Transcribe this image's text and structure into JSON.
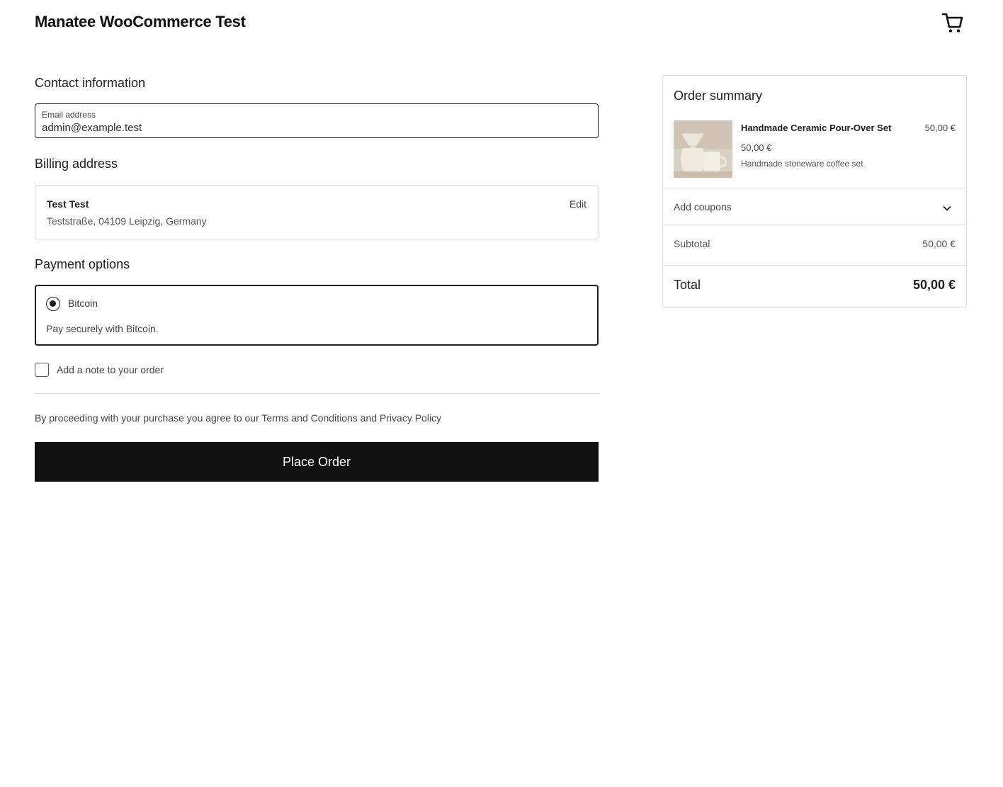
{
  "header": {
    "site_title": "Manatee WooCommerce Test",
    "cart_icon": "cart-icon"
  },
  "contact": {
    "title": "Contact information",
    "email_label": "Email address",
    "email_value": "admin@example.test"
  },
  "billing": {
    "title": "Billing address",
    "name": "Test Test",
    "address_line": "Teststraße, 04109 Leipzig, Germany",
    "edit_label": "Edit"
  },
  "payment": {
    "title": "Payment options",
    "selected_method": "Bitcoin",
    "description": "Pay securely with Bitcoin."
  },
  "note": {
    "label": "Add a note to your order",
    "checked": false
  },
  "terms_text": "By proceeding with your purchase you agree to our Terms and Conditions and Privacy Policy",
  "place_order_label": "Place Order",
  "summary": {
    "title": "Order summary",
    "item": {
      "name": "Handmade Ceramic Pour-Over Set",
      "line_total": "50,00 €",
      "unit_price": "50,00 €",
      "description": "Handmade stoneware coffee set"
    },
    "coupons_label": "Add coupons",
    "subtotal_label": "Subtotal",
    "subtotal_value": "50,00 €",
    "total_label": "Total",
    "total_value": "50,00 €"
  },
  "colors": {
    "primary_button": "#111111",
    "border": "#dcdcdc",
    "text": "#1e1e1e"
  }
}
